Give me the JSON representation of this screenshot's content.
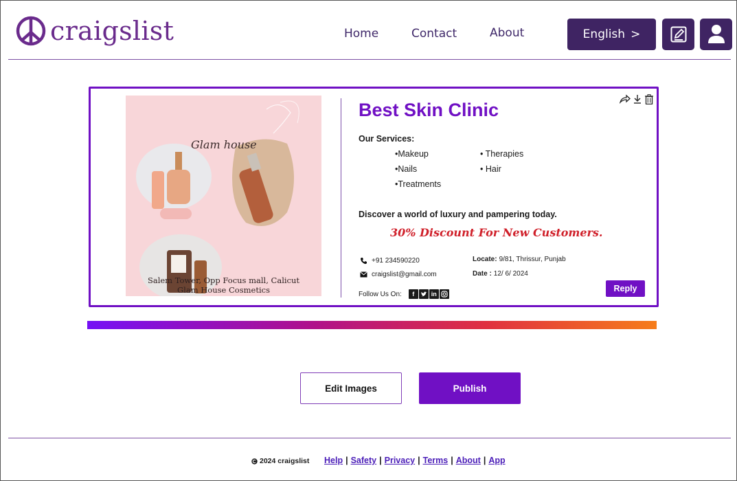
{
  "header": {
    "logo_text": "craigslist",
    "nav": [
      "Home",
      "Contact",
      "About"
    ],
    "language_label": "English",
    "language_chevron": ">",
    "icons": [
      "edit-icon",
      "user-icon"
    ]
  },
  "card": {
    "image_alt": "Glam house skincare products",
    "image_script_text": "Glam house",
    "image_caption_line1": "Salem Tower, Opp Focus mall, Calicut",
    "image_caption_line2": "Glam House Cosmetics",
    "title": "Best Skin Clinic",
    "services_heading": "Our Services:",
    "services_col1": [
      "•Makeup",
      "•Nails",
      "•Treatments"
    ],
    "services_col2": [
      "• Therapies",
      "• Hair"
    ],
    "tagline": "Discover  a world of luxury and pampering today.",
    "discount": "30% Discount For New Customers.",
    "phone": "+91 234590220",
    "email": "craigslist@gmail.com",
    "locate_label": "Locate:",
    "locate_value": "9/81, Thrissur, Punjab",
    "date_label": "Date :",
    "date_value": "12/ 6/ 2024",
    "follow_label": "Follow Us On:",
    "social_icons": [
      "facebook-icon",
      "twitter-icon",
      "linkedin-icon",
      "instagram-icon"
    ],
    "reply_label": "Reply",
    "tool_icons": [
      "share-icon",
      "download-icon",
      "delete-icon"
    ]
  },
  "actions": {
    "edit_images": "Edit Images",
    "publish": "Publish"
  },
  "footer": {
    "copyright": "2024 craigslist",
    "links": [
      "Help",
      "Safety",
      "Privacy",
      "Terms",
      "About",
      "App"
    ]
  },
  "colors": {
    "brand_purple": "#7010c4",
    "header_dark": "#3f2463",
    "logo_purple": "#6a2b8c",
    "discount_red": "#d0202a"
  }
}
